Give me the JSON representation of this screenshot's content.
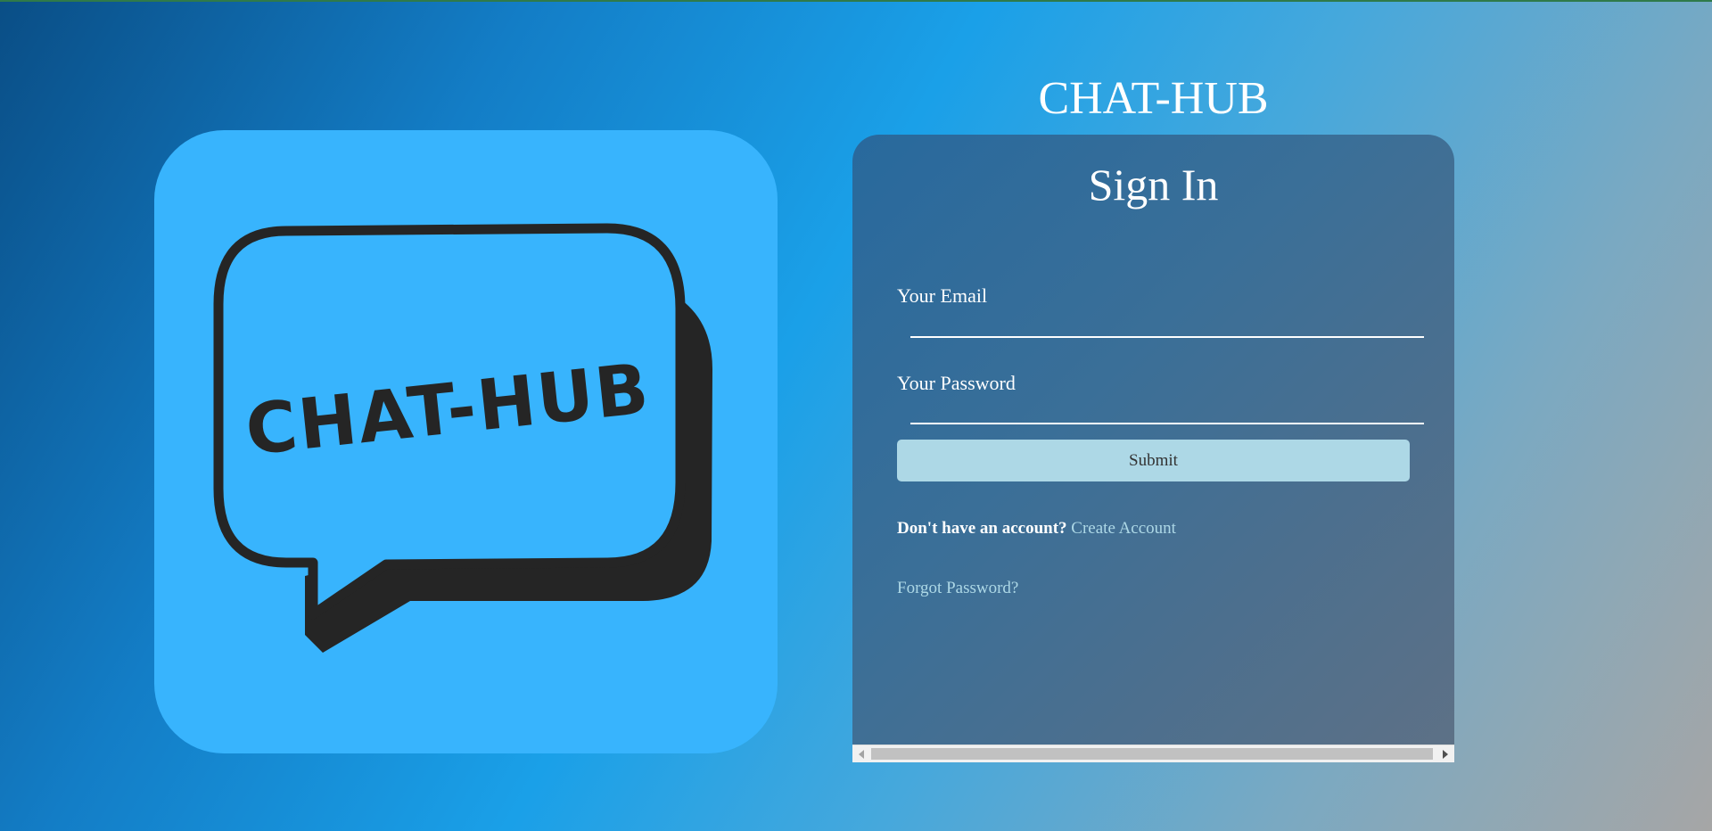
{
  "app": {
    "title": "CHAT-HUB",
    "logo_text": "CHAT-HUB"
  },
  "colors": {
    "logo_background": "#38b4fd",
    "bubble_ink": "#252525",
    "submit_button": "#add8e6",
    "link": "#add8e6"
  },
  "signin": {
    "heading": "Sign In",
    "email": {
      "label": "Your Email",
      "value": "",
      "placeholder": ""
    },
    "password": {
      "label": "Your Password",
      "value": "",
      "placeholder": ""
    },
    "submit_label": "Submit",
    "account_prompt": "Don't have an account?",
    "create_account_label": "Create Account",
    "forgot_password_label": "Forgot Password?"
  },
  "icons": {
    "logo": "speech-bubble-icon",
    "scroll_left": "triangle-left-icon",
    "scroll_right": "triangle-right-icon"
  }
}
